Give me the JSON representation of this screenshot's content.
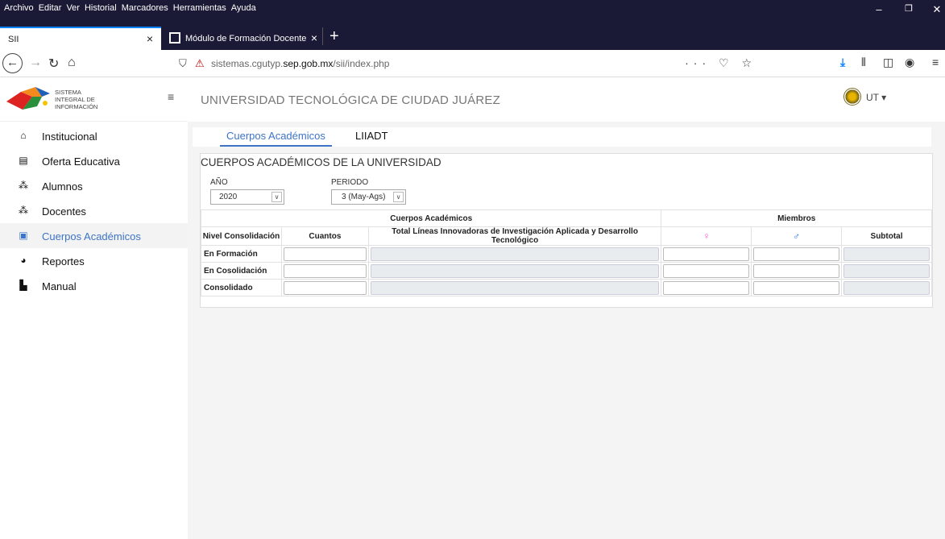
{
  "browser": {
    "menu": [
      "Archivo",
      "Editar",
      "Ver",
      "Historial",
      "Marcadores",
      "Herramientas",
      "Ayuda"
    ],
    "tabs": [
      {
        "title": "SII",
        "close": "×"
      },
      {
        "title": "Módulo de Formación Docente",
        "close": "×"
      }
    ],
    "newtab": "+",
    "url_prefix": "sistemas.cgutyp.",
    "url_domain": "sep.gob.mx",
    "url_path": "/sii/index.php",
    "url_actions": "··· ♡ ☆"
  },
  "sidebar": {
    "brand_lines": [
      "SISTEMA",
      "INTEGRAL DE",
      "INFORMACIÓN"
    ],
    "toggle": "≡",
    "items": [
      {
        "label": "Institucional",
        "icon": "home-icon",
        "glyph": "🏠"
      },
      {
        "label": "Oferta Educativa",
        "icon": "book-icon",
        "glyph": "▤"
      },
      {
        "label": "Alumnos",
        "icon": "users-icon",
        "glyph": "👥"
      },
      {
        "label": "Docentes",
        "icon": "users-icon",
        "glyph": "👥"
      },
      {
        "label": "Cuerpos Académicos",
        "icon": "id-card-icon",
        "glyph": "▣",
        "active": true
      },
      {
        "label": "Reportes",
        "icon": "chart-pie-icon",
        "glyph": "◕"
      },
      {
        "label": "Manual",
        "icon": "file-pdf-icon",
        "glyph": "▙"
      }
    ]
  },
  "header": {
    "university": "UNIVERSIDAD TECNOLÓGICA DE CIUDAD JUÁREZ",
    "user_label": "UT ▾"
  },
  "tabs": {
    "active": "Cuerpos Académicos",
    "second": "LIIADT"
  },
  "panel": {
    "title": "CUERPOS ACADÉMICOS DE LA UNIVERSIDAD",
    "year_label": "AÑO",
    "year_value": "2020",
    "period_label": "PERIODO",
    "period_value": "3 (May-Ags)"
  },
  "table": {
    "group_headers": [
      "Cuerpos Académicos",
      "Miembros"
    ],
    "columns": [
      "Nivel Consolidación",
      "Cuantos",
      "Total Líneas Innovadoras de Investigación Aplicada y Desarrollo Tecnológico",
      "♀",
      "♂",
      "Subtotal"
    ],
    "rows": [
      "En Formación",
      "En Cosolidación",
      "Consolidado"
    ]
  },
  "colors": {
    "accent": "#3d74c7",
    "chrome_dark": "#1a1a36",
    "female": "#ff4fd8",
    "male": "#1f6fd8"
  }
}
